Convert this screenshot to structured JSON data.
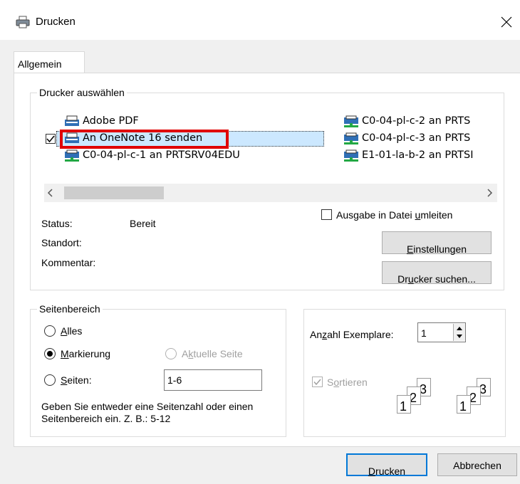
{
  "window": {
    "title": "Drucken"
  },
  "tabs": [
    {
      "label": "Allgemein",
      "active": true
    }
  ],
  "printer_group": {
    "legend": "Drucker auswählen",
    "printers": [
      {
        "name": "Adobe PDF",
        "icon": "printer-icon",
        "selected": false
      },
      {
        "name": "An OneNote 16 senden",
        "icon": "printer-icon",
        "selected": true,
        "highlighted": true
      },
      {
        "name": "C0-04-pl-c-1 an PRTSRV04EDU",
        "icon": "network-printer-icon",
        "selected": false
      },
      {
        "name": "C0-04-pl-c-2 an PRTS",
        "icon": "network-printer-icon",
        "selected": false
      },
      {
        "name": "C0-04-pl-c-3 an PRTS",
        "icon": "network-printer-icon",
        "selected": false
      },
      {
        "name": "E1-01-la-b-2 an PRTSI",
        "icon": "network-printer-icon",
        "selected": false
      }
    ],
    "status_label": "Status:",
    "status_value": "Bereit",
    "location_label": "Standort:",
    "comment_label": "Kommentar:",
    "print_to_file": {
      "pre": "Ausgabe in Datei ",
      "accel": "u",
      "post": "mleiten",
      "checked": false
    },
    "settings_button": {
      "pre": "",
      "accel": "E",
      "post": "instellungen"
    },
    "find_printer_button": {
      "pre": "Dr",
      "accel": "u",
      "post": "cker suchen..."
    }
  },
  "page_range": {
    "legend": "Seitenbereich",
    "all": {
      "pre": "",
      "accel": "A",
      "post": "lles",
      "checked": false
    },
    "selection": {
      "pre": "",
      "accel": "M",
      "post": "arkierung",
      "checked": true
    },
    "current_page": {
      "pre": "A",
      "accel": "k",
      "post": "tuelle Seite",
      "checked": false,
      "disabled": true
    },
    "pages": {
      "pre": "",
      "accel": "S",
      "post": "eiten:",
      "checked": false
    },
    "pages_value": "1-6",
    "hint": "Geben Sie entweder eine Seitenzahl oder einen Seitenbereich ein. Z. B.: 5-12"
  },
  "copies": {
    "label": {
      "pre": "An",
      "accel": "z",
      "post": "ahl Exemplare:"
    },
    "value": "1",
    "collate": {
      "pre": "S",
      "accel": "o",
      "post": "rtieren",
      "checked": true,
      "disabled": true
    },
    "collate_pages": [
      "1",
      "2",
      "3"
    ]
  },
  "footer": {
    "print_button": {
      "pre": "",
      "accel": "D",
      "post": "rucken"
    },
    "cancel_button": "Abbrechen"
  }
}
